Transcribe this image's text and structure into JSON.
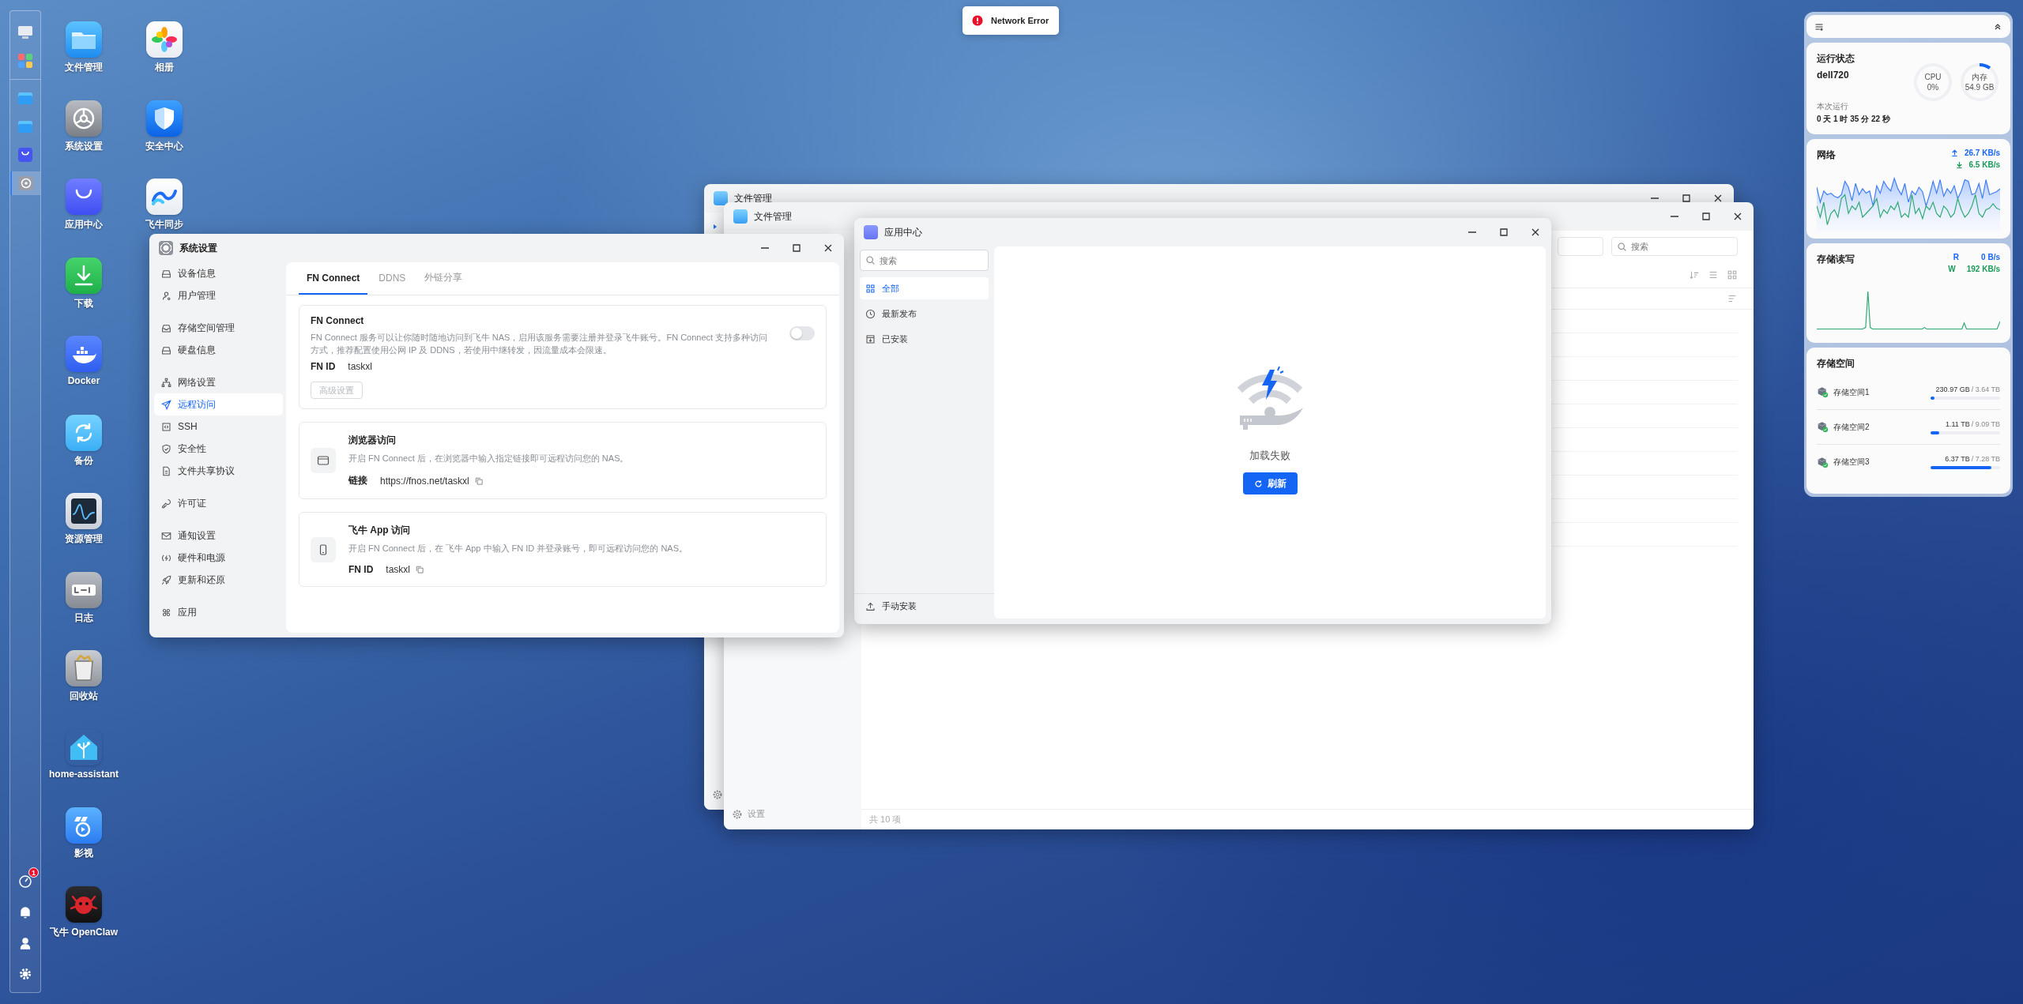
{
  "dock": {
    "top_items": [
      {
        "kind": "monitor",
        "selected": false
      },
      {
        "kind": "apps",
        "selected": false
      },
      {
        "kind": "folder",
        "selected": false
      },
      {
        "kind": "folder",
        "selected": false
      },
      {
        "kind": "store",
        "selected": false
      },
      {
        "kind": "settings",
        "selected": true
      }
    ],
    "bottom_items": [
      {
        "kind": "speed",
        "badge": "1"
      },
      {
        "kind": "bell"
      },
      {
        "kind": "user"
      },
      {
        "kind": "gear"
      }
    ]
  },
  "desktop_icons": [
    {
      "label": "文件管理",
      "kind": "folder"
    },
    {
      "label": "系统设置",
      "kind": "settings"
    },
    {
      "label": "应用中心",
      "kind": "store"
    },
    {
      "label": "下载",
      "kind": "download"
    },
    {
      "label": "Docker",
      "kind": "docker"
    },
    {
      "label": "备份",
      "kind": "backup"
    },
    {
      "label": "资源管理",
      "kind": "monitor"
    },
    {
      "label": "日志",
      "kind": "log"
    },
    {
      "label": "回收站",
      "kind": "trash"
    },
    {
      "label": "home-assistant",
      "kind": "home"
    },
    {
      "label": "影视",
      "kind": "video"
    },
    {
      "label": "飞牛 OpenClaw",
      "kind": "claw"
    },
    {
      "label": "相册",
      "kind": "photos"
    },
    {
      "label": "安全中心",
      "kind": "shield"
    },
    {
      "label": "飞牛同步",
      "kind": "sync"
    }
  ],
  "toast": {
    "message": "Network Error"
  },
  "file_manager_back": {
    "title": "文件管理"
  },
  "file_manager_front": {
    "title": "文件管理",
    "search": {
      "placeholder": "搜索"
    },
    "sidebar_footer": "设置",
    "item_count": "共 10 项"
  },
  "app_center": {
    "title": "应用中心",
    "search": {
      "placeholder": "搜索"
    },
    "nav": [
      {
        "label": "全部",
        "kind": "grid",
        "selected": true
      },
      {
        "label": "最新发布",
        "kind": "clock",
        "selected": false
      },
      {
        "label": "已安装",
        "kind": "installed",
        "selected": false
      }
    ],
    "footer": "手动安装",
    "error": {
      "message": "加载失败",
      "button": "刷新"
    }
  },
  "settings": {
    "title": "系统设置",
    "nav_groups": [
      {
        "items": [
          {
            "label": "设备信息",
            "kind": "drive",
            "selected": false
          },
          {
            "label": "用户管理",
            "kind": "user",
            "selected": false
          }
        ]
      },
      {
        "items": [
          {
            "label": "存储空间管理",
            "kind": "tray",
            "selected": false
          },
          {
            "label": "硬盘信息",
            "kind": "drive",
            "selected": false
          }
        ]
      },
      {
        "items": [
          {
            "label": "网络设置",
            "kind": "network",
            "selected": false
          },
          {
            "label": "远程访问",
            "kind": "send",
            "selected": true
          },
          {
            "label": "SSH",
            "kind": "code",
            "selected": false
          },
          {
            "label": "安全性",
            "kind": "shield",
            "selected": false
          },
          {
            "label": "文件共享协议",
            "kind": "document",
            "selected": false
          }
        ]
      },
      {
        "items": [
          {
            "label": "许可证",
            "kind": "key",
            "selected": false
          }
        ]
      },
      {
        "items": [
          {
            "label": "通知设置",
            "kind": "mail",
            "selected": false
          },
          {
            "label": "硬件和电源",
            "kind": "power",
            "selected": false
          },
          {
            "label": "更新和还原",
            "kind": "rocket",
            "selected": false
          }
        ]
      },
      {
        "items": [
          {
            "label": "应用",
            "kind": "apps",
            "selected": false
          }
        ]
      }
    ],
    "tabs": [
      {
        "label": "FN Connect",
        "selected": true
      },
      {
        "label": "DDNS",
        "selected": false
      },
      {
        "label": "外链分享",
        "selected": false
      }
    ],
    "connect_card": {
      "title": "FN Connect",
      "description": "FN Connect 服务可以让你随时随地访问到飞牛 NAS，启用该服务需要注册并登录飞牛账号。FN Connect 支持多种访问方式，推荐配置使用公网 IP 及 DDNS，若使用中继转发，因流量成本会限速。",
      "on": false,
      "field": {
        "label": "FN ID",
        "value": "taskxl"
      },
      "button": {
        "label": "高级设置",
        "disabled": true
      }
    },
    "access_cards": [
      {
        "kind": "browser",
        "title": "浏览器访问",
        "description": "开启 FN Connect 后，在浏览器中输入指定链接即可远程访问您的 NAS。",
        "field": {
          "label": "链接",
          "value": "https://fnos.net/taskxl"
        }
      },
      {
        "kind": "phone",
        "title": "飞牛 App 访问",
        "description": "开启 FN Connect 后，在 飞牛 App 中输入 FN ID 并登录账号，即可远程访问您的 NAS。",
        "field": {
          "label": "FN ID",
          "value": "taskxl"
        }
      }
    ]
  },
  "widgets": {
    "status": {
      "title": "运行状态",
      "host": "dell720",
      "uptime_label": "本次运行",
      "uptime": "0 天 1 时 35 分 22 秒",
      "gauges": [
        {
          "label": "CPU",
          "value": "0%"
        },
        {
          "label": "内存",
          "value": "54.9 GB",
          "level": 0.1
        }
      ]
    },
    "network": {
      "title": "网络",
      "upload": "26.7 KB/s",
      "download": "6.5 KB/s"
    },
    "disk_io": {
      "title": "存储读写",
      "read_label": "R",
      "read": "0 B/s",
      "write_label": "W",
      "write": "192 KB/s"
    },
    "storage": {
      "title": "存储空间",
      "volumes": [
        {
          "name": "存储空间1",
          "used": "230.97 GB",
          "total": "/ 3.64 TB",
          "level": 0.06
        },
        {
          "name": "存储空间2",
          "used": "1.11 TB",
          "total": "/ 9.09 TB",
          "level": 0.12
        },
        {
          "name": "存储空间3",
          "used": "6.37 TB",
          "total": "/ 7.28 TB",
          "level": 0.87
        }
      ]
    }
  }
}
